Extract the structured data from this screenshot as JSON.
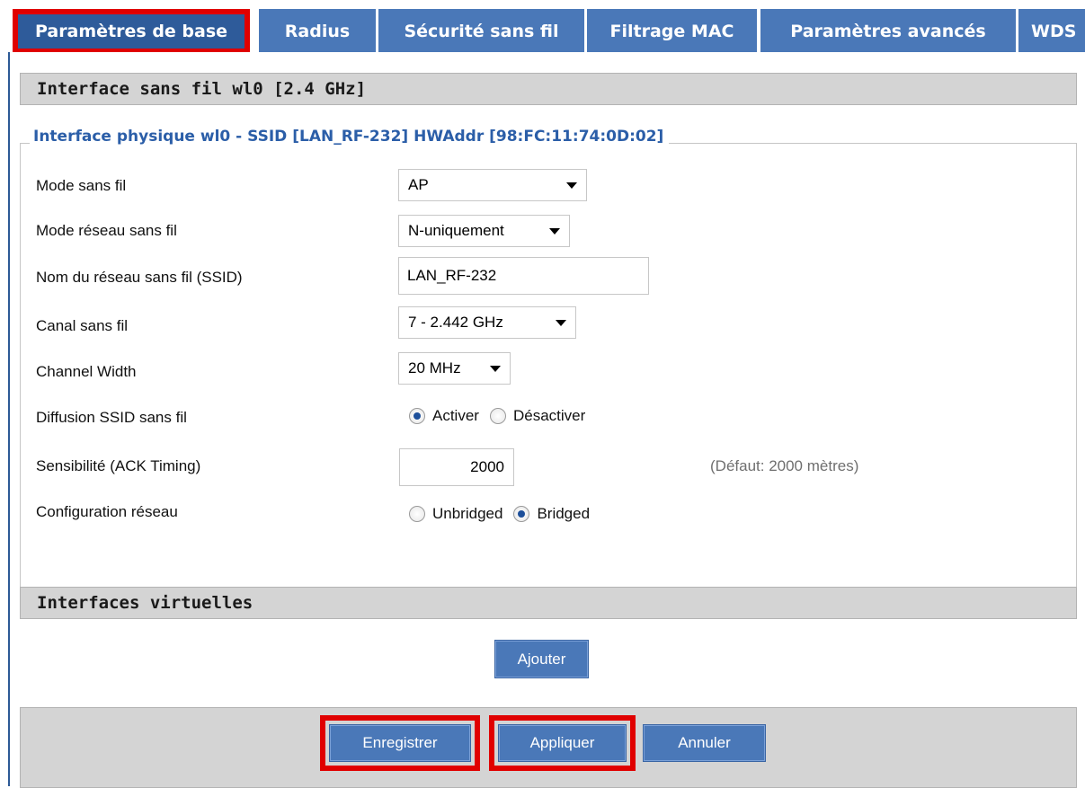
{
  "tabs": [
    {
      "label": "Paramètres de base",
      "active": true
    },
    {
      "label": "Radius",
      "active": false
    },
    {
      "label": "Sécurité sans fil",
      "active": false
    },
    {
      "label": "Filtrage MAC",
      "active": false
    },
    {
      "label": "Paramètres avancés",
      "active": false
    },
    {
      "label": "WDS",
      "active": false
    }
  ],
  "interface_header": "Interface sans fil wl0 [2.4 GHz]",
  "physical": {
    "legend": "Interface physique wl0 - SSID [LAN_RF-232] HWAddr [98:FC:11:74:0D:02]",
    "wireless_mode": {
      "label": "Mode sans fil",
      "value": "AP"
    },
    "network_mode": {
      "label": "Mode réseau sans fil",
      "value": "N-uniquement"
    },
    "ssid": {
      "label": "Nom du réseau sans fil (SSID)",
      "value": "LAN_RF-232"
    },
    "channel": {
      "label": "Canal sans fil",
      "value": "7 - 2.442 GHz"
    },
    "channel_width": {
      "label": "Channel Width",
      "value": "20 MHz"
    },
    "ssid_broadcast": {
      "label": "Diffusion SSID sans fil",
      "options": [
        "Activer",
        "Désactiver"
      ],
      "selected": "Activer"
    },
    "ack_timing": {
      "label": "Sensibilité (ACK Timing)",
      "value": "2000",
      "hint": "(Défaut: 2000 mètres)"
    },
    "network_config": {
      "label": "Configuration réseau",
      "options": [
        "Unbridged",
        "Bridged"
      ],
      "selected": "Bridged"
    }
  },
  "virtual_header": "Interfaces virtuelles",
  "buttons": {
    "add": "Ajouter",
    "save": "Enregistrer",
    "apply": "Appliquer",
    "cancel": "Annuler"
  },
  "colors": {
    "tab_blue": "#4a78b8",
    "tab_active": "#2e5b9a",
    "highlight_red": "#e00000",
    "legend_blue": "#2b5ea8"
  }
}
